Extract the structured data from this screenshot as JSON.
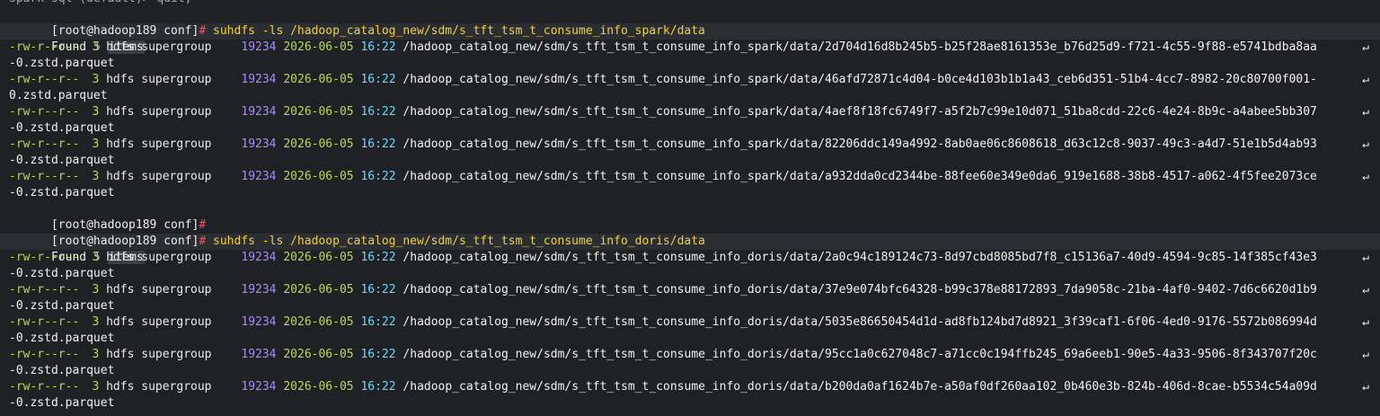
{
  "terminal": {
    "top_cut": "spark-sql (default)> quit;",
    "blocks": [
      {
        "prompt": "[root@hadoop189 conf]",
        "hash": "#",
        "command": "suhdfs",
        "flag": "-ls",
        "arg": "/hadoop_catalog_new/sdm/s_tft_tsm_t_consume_info_spark/data",
        "found_label": "Found",
        "found_count": "5",
        "found_items": "items",
        "rows": [
          {
            "perm": "-rw-r--r--",
            "repl": "3",
            "owner": "hdfs supergroup",
            "size": "19234",
            "date": "2026-06-05",
            "time": "16:22",
            "path": "/hadoop_catalog_new/sdm/s_tft_tsm_t_consume_info_spark/data/2d704d16d8b245b5-b25f28ae8161353e_b76d25d9-f721-4c55-9f88-e5741bdba8aa",
            "wrap": "-0.zstd.parquet"
          },
          {
            "perm": "-rw-r--r--",
            "repl": "3",
            "owner": "hdfs supergroup",
            "size": "19234",
            "date": "2026-06-05",
            "time": "16:22",
            "path": "/hadoop_catalog_new/sdm/s_tft_tsm_t_consume_info_spark/data/46afd72871c4d04-b0ce4d103b1b1a43_ceb6d351-51b4-4cc7-8982-20c80700f001-",
            "wrap": "0.zstd.parquet"
          },
          {
            "perm": "-rw-r--r--",
            "repl": "3",
            "owner": "hdfs supergroup",
            "size": "19234",
            "date": "2026-06-05",
            "time": "16:22",
            "path": "/hadoop_catalog_new/sdm/s_tft_tsm_t_consume_info_spark/data/4aef8f18fc6749f7-a5f2b7c99e10d071_51ba8cdd-22c6-4e24-8b9c-a4abee5bb307",
            "wrap": "-0.zstd.parquet"
          },
          {
            "perm": "-rw-r--r--",
            "repl": "3",
            "owner": "hdfs supergroup",
            "size": "19234",
            "date": "2026-06-05",
            "time": "16:22",
            "path": "/hadoop_catalog_new/sdm/s_tft_tsm_t_consume_info_spark/data/82206ddc149a4992-8ab0ae06c8608618_d63c12c8-9037-49c3-a4d7-51e1b5d4ab93",
            "wrap": "-0.zstd.parquet"
          },
          {
            "perm": "-rw-r--r--",
            "repl": "3",
            "owner": "hdfs supergroup",
            "size": "19234",
            "date": "2026-06-05",
            "time": "16:22",
            "path": "/hadoop_catalog_new/sdm/s_tft_tsm_t_consume_info_spark/data/a932dda0cd2344be-88fee60e349e0da6_919e1688-38b8-4517-a062-4f5fee2073ce",
            "wrap": "-0.zstd.parquet"
          }
        ]
      },
      {
        "prompt": "[root@hadoop189 conf]",
        "hash": "#",
        "command": "suhdfs",
        "flag": "-ls",
        "arg": "/hadoop_catalog_new/sdm/s_tft_tsm_t_consume_info_doris/data",
        "found_label": "Found",
        "found_count": "5",
        "found_items": "items",
        "rows": [
          {
            "perm": "-rw-r--r--",
            "repl": "3",
            "owner": "hdfs supergroup",
            "size": "19234",
            "date": "2026-06-05",
            "time": "16:22",
            "path": "/hadoop_catalog_new/sdm/s_tft_tsm_t_consume_info_doris/data/2a0c94c189124c73-8d97cbd8085bd7f8_c15136a7-40d9-4594-9c85-14f385cf43e3",
            "wrap": "-0.zstd.parquet"
          },
          {
            "perm": "-rw-r--r--",
            "repl": "3",
            "owner": "hdfs supergroup",
            "size": "19234",
            "date": "2026-06-05",
            "time": "16:22",
            "path": "/hadoop_catalog_new/sdm/s_tft_tsm_t_consume_info_doris/data/37e9e074bfc64328-b99c378e88172893_7da9058c-21ba-4af0-9402-7d6c6620d1b9",
            "wrap": "-0.zstd.parquet"
          },
          {
            "perm": "-rw-r--r--",
            "repl": "3",
            "owner": "hdfs supergroup",
            "size": "19234",
            "date": "2026-06-05",
            "time": "16:22",
            "path": "/hadoop_catalog_new/sdm/s_tft_tsm_t_consume_info_doris/data/5035e86650454d1d-ad8fb124bd7d8921_3f39caf1-6f06-4ed0-9176-5572b086994d",
            "wrap": "-0.zstd.parquet"
          },
          {
            "perm": "-rw-r--r--",
            "repl": "3",
            "owner": "hdfs supergroup",
            "size": "19234",
            "date": "2026-06-05",
            "time": "16:22",
            "path": "/hadoop_catalog_new/sdm/s_tft_tsm_t_consume_info_doris/data/95cc1a0c627048c7-a71cc0c194ffb245_69a6eeb1-90e5-4a33-9506-8f343707f20c",
            "wrap": "-0.zstd.parquet"
          },
          {
            "perm": "-rw-r--r--",
            "repl": "3",
            "owner": "hdfs supergroup",
            "size": "19234",
            "date": "2026-06-05",
            "time": "16:22",
            "path": "/hadoop_catalog_new/sdm/s_tft_tsm_t_consume_info_doris/data/b200da0af1624b7e-a50af0df260aa102_0b460e3b-824b-406d-8cae-b5534c54a09d",
            "wrap": "-0.zstd.parquet"
          }
        ]
      }
    ],
    "idle_prompt": "[root@hadoop189 conf]",
    "idle_hash": "#"
  }
}
